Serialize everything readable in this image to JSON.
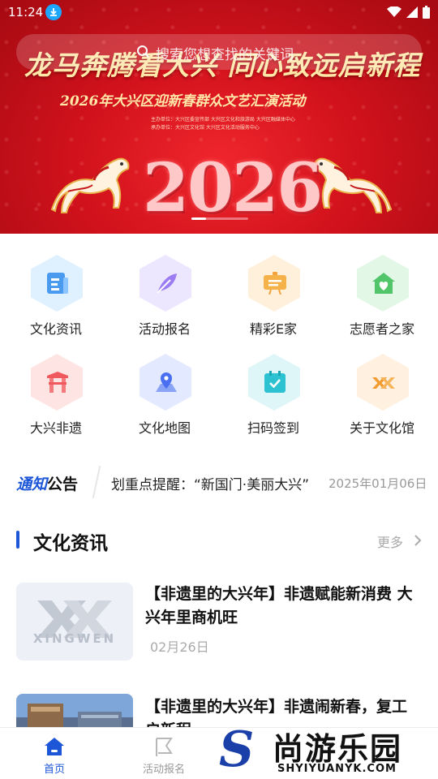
{
  "status_bar": {
    "time": "11:24"
  },
  "search": {
    "placeholder": "搜索您想查找的关键词"
  },
  "banner": {
    "title": "龙马奔腾看大兴  同心致远启新程",
    "subtitle": "2026年大兴区迎新春群众文艺汇演活动",
    "organizers": [
      "主办单位：大兴区委宣传部  大兴区文化和旅游局  大兴区融媒体中心",
      "承办单位：大兴区文化馆  大兴区文化活动服务中心"
    ],
    "year": "2026"
  },
  "grid": [
    {
      "label": "文化资讯",
      "icon": "document-icon"
    },
    {
      "label": "活动报名",
      "icon": "feather-icon"
    },
    {
      "label": "精彩E家",
      "icon": "easel-icon"
    },
    {
      "label": "志愿者之家",
      "icon": "heart-house-icon"
    },
    {
      "label": "大兴非遗",
      "icon": "gate-icon"
    },
    {
      "label": "文化地图",
      "icon": "map-pin-icon"
    },
    {
      "label": "扫码签到",
      "icon": "calendar-check-icon"
    },
    {
      "label": "关于文化馆",
      "icon": "xx-logo-icon"
    }
  ],
  "notice": {
    "badge_blue": "通知",
    "badge_black": "公告",
    "text": "划重点提醒：“新国门·美丽大兴”",
    "date": "2025年01月06日"
  },
  "section": {
    "title": "文化资讯",
    "more": "更多"
  },
  "news": [
    {
      "title": "【非遗里的大兴年】非遗赋能新消费 大兴年里商机旺",
      "date": "02月26日",
      "thumb_logo_text": "XINGWEN"
    },
    {
      "title": "【非遗里的大兴年】非遗闹新春，复工启新程",
      "date": ""
    }
  ],
  "tabbar": [
    {
      "label": "首页",
      "active": true
    },
    {
      "label": "活动报名",
      "active": false
    }
  ],
  "watermark": {
    "cn": "尚游乐园",
    "en": "SHYIYUANYK.COM",
    "s": "S"
  },
  "colors": {
    "primary": "#1d57d8",
    "banner_red": "#d2121c"
  }
}
